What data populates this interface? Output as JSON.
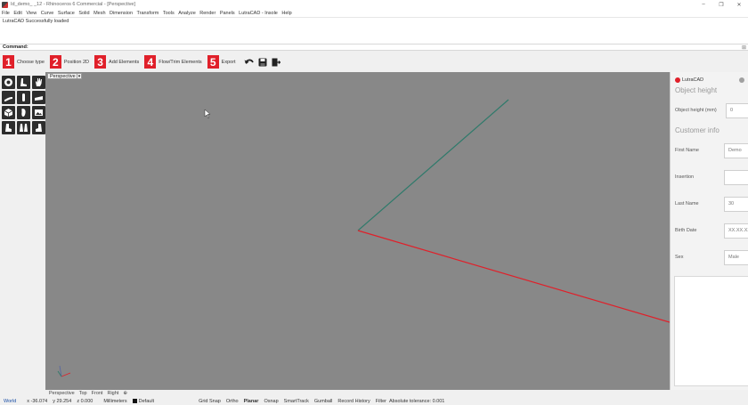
{
  "window": {
    "title": "Id_demo_ _12 - Rhinoceros 6 Commercial - [Perspective]",
    "controls": [
      "–",
      "❐",
      "✕"
    ]
  },
  "menu": [
    "File",
    "Edit",
    "View",
    "Curve",
    "Surface",
    "Solid",
    "Mesh",
    "Dimension",
    "Transform",
    "Tools",
    "Analyze",
    "Render",
    "Panels",
    "LutraCAD - Insole",
    "Help"
  ],
  "command_history": "LutraCAD Successfully loaded",
  "command_line": {
    "label": "Command:",
    "value": "",
    "expand": "⊞"
  },
  "toolbar": {
    "steps": [
      {
        "num": "1",
        "label": "Choose type"
      },
      {
        "num": "2",
        "label": "Position 2D"
      },
      {
        "num": "3",
        "label": "Add Elements"
      },
      {
        "num": "4",
        "label": "Flow/Trim Elements"
      },
      {
        "num": "5",
        "label": "Export"
      }
    ],
    "icons": [
      "undo-icon",
      "save-icon",
      "exit-icon"
    ]
  },
  "left_tools": [
    "foot-scan-icon",
    "foot-side-icon",
    "hand-icon",
    "insole-heel-icon",
    "insole-front-icon",
    "insole-flat-icon",
    "box-icon",
    "insole-top-icon",
    "image-icon",
    "boot-left-icon",
    "feet-pair-icon",
    "boot-right-icon"
  ],
  "viewport": {
    "label": "Perspective",
    "dropdown": "▾",
    "background": "#888888",
    "green_axis_color": "#2f7a6b",
    "red_axis_color": "#e0202a"
  },
  "panel": {
    "title": "LutraCAD",
    "section1": "Object height",
    "fields1": [
      {
        "label": "Object height (mm)",
        "value": "0"
      }
    ],
    "section2": "Customer info",
    "fields2": [
      {
        "label": "First Name",
        "value": "Demo"
      },
      {
        "label": "Insertion",
        "value": ""
      },
      {
        "label": "Last Name",
        "value": "30"
      },
      {
        "label": "Birth Date",
        "value": "XX.XX.XXXX"
      },
      {
        "label": "Sex",
        "value": "Male"
      }
    ]
  },
  "view_tabs": [
    "Perspective",
    "Top",
    "Front",
    "Right",
    "⊕"
  ],
  "status": {
    "cplane": "World",
    "x": "x -36.074",
    "y": "y 29.254",
    "z": "z 0.000",
    "units": "Millimeters",
    "layer": "Default",
    "toggles": [
      "Grid Snap",
      "Ortho",
      "Planar",
      "Osnap",
      "SmartTrack",
      "Gumball",
      "Record History",
      "Filter"
    ],
    "tolerance": "Absolute tolerance: 0.001"
  }
}
